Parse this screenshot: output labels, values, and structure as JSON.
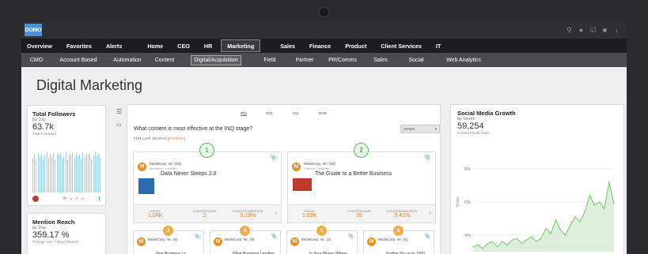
{
  "app": {
    "logo": "DOMO"
  },
  "nav1": [
    "Overview",
    "Favorites",
    "Alerts",
    "Home",
    "CEO",
    "HR",
    "Marketing",
    "Sales",
    "Finance",
    "Product",
    "Client Services",
    "IT"
  ],
  "nav1_active": "Marketing",
  "nav2": [
    "CMO",
    "Account Based",
    "Automation",
    "Content",
    "Digital/Acquisition",
    "Field",
    "Partner",
    "PR/Comms",
    "Sales",
    "Social",
    "Web Analytics"
  ],
  "nav2_active": "Digital/Acquisition",
  "page": {
    "title": "Digital Marketing"
  },
  "followers": {
    "title": "Total Followers",
    "sub": "by Day",
    "value": "63.7k",
    "caption": "Total Followers",
    "views": "0",
    "comments": "0",
    "bars": [
      0.62,
      0.7,
      0.58,
      0.72,
      0.65,
      0.7,
      0.6,
      0.68,
      0.74,
      0.63,
      0.7,
      0.66,
      0.71,
      0.6,
      0.7,
      0.68,
      0.72,
      0.62,
      0.66,
      0.74,
      0.6,
      0.7,
      0.67,
      0.72,
      0.64,
      0.71,
      0.66,
      0.69,
      0.62,
      0.73,
      0.65,
      0.7,
      0.68,
      0.72,
      0.62,
      0.67,
      0.74,
      0.66,
      0.7,
      0.63
    ]
  },
  "mention": {
    "title": "Mention Reach",
    "sub": "by Day",
    "value": "359.17 %",
    "caption": "Change over 7 Days (Reach)"
  },
  "center": {
    "tabs": [
      "INQ",
      "MQL",
      "SQL",
      "MQR"
    ],
    "question": "What content is most effective at the INQ stage?",
    "dropdown": "VIEWS",
    "period_prefix": "FOR LAST 28 DAYS (",
    "period_link": "CHANGE",
    "period_suffix": ")",
    "cards": [
      {
        "rank": "1",
        "org": "ModoCorp, Inc. (18)",
        "sub": "Mentions | LinkedIn",
        "title": "Data Never Sleeps 2.0",
        "views": "1.04K",
        "conversions": "2",
        "rate": "0.19%"
      },
      {
        "rank": "2",
        "org": "ModoCorp, Inc. (16)",
        "sub": "Content | LinkedIn",
        "title": "The Guide to a Better Business",
        "views": "1.03K",
        "conversions": "35",
        "rate": "3.41%"
      }
    ],
    "metric_labels": {
      "views": "VIEWS",
      "conversions": "CONVERSIONS",
      "rate": "CONVERSION RATE"
    },
    "small_cards": [
      {
        "rank": "3",
        "org": "ModoCorp, Inc. (6)",
        "title": "Five Business Le..."
      },
      {
        "rank": "4",
        "org": "ModoCorp, Inc. (5)",
        "title": "What Business Leaders"
      },
      {
        "rank": "5",
        "org": "ModoCorp, Inc. (2)",
        "title": "Is Your Money Where"
      },
      {
        "rank": "6",
        "org": "ModoCorp, Inc. (1)",
        "title": "Ending Six up to 1000"
      }
    ]
  },
  "social": {
    "title": "Social Media Growth",
    "sub": "by Month",
    "value": "59,254",
    "caption": "Current Month Visits",
    "ylabel": "Visits"
  },
  "chart_data": {
    "type": "area",
    "title": "Social Media Growth",
    "ylabel": "Visits",
    "yticks": [
      "80k",
      "60k",
      "40k"
    ],
    "ylim": [
      30000,
      90000
    ],
    "values": [
      33000,
      34000,
      32000,
      35000,
      36000,
      33000,
      36000,
      34000,
      37000,
      38000,
      35000,
      37000,
      39000,
      36000,
      38000,
      44000,
      41000,
      49000,
      43000,
      40000,
      46000,
      51000,
      48000,
      54000,
      64000,
      58000,
      60000,
      56000,
      72000,
      59000
    ]
  }
}
